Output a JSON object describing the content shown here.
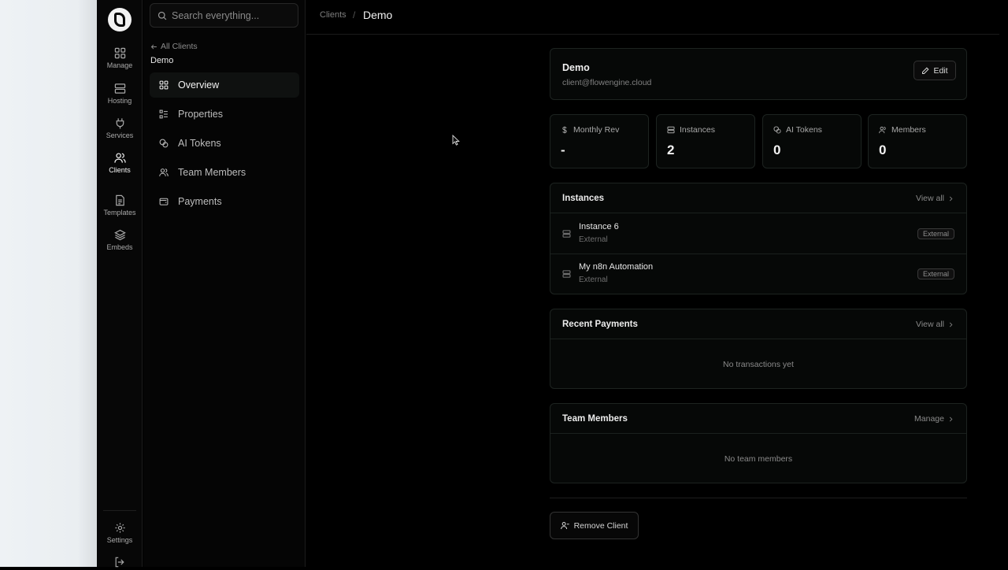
{
  "rail": {
    "items": [
      {
        "label": "Manage",
        "icon": "grid-icon"
      },
      {
        "label": "Hosting",
        "icon": "server-icon"
      },
      {
        "label": "Services",
        "icon": "plug-icon"
      },
      {
        "label": "Clients",
        "icon": "users-icon",
        "active": true
      },
      {
        "label": "Templates",
        "icon": "document-icon"
      },
      {
        "label": "Embeds",
        "icon": "layers-icon"
      }
    ],
    "settings_label": "Settings"
  },
  "search": {
    "placeholder": "Search everything..."
  },
  "subnav": {
    "back_label": "All Clients",
    "client_name": "Demo",
    "items": [
      {
        "label": "Overview",
        "icon": "dashboard-icon",
        "active": true
      },
      {
        "label": "Properties",
        "icon": "list-icon"
      },
      {
        "label": "AI Tokens",
        "icon": "coins-icon"
      },
      {
        "label": "Team Members",
        "icon": "team-icon"
      },
      {
        "label": "Payments",
        "icon": "wallet-icon"
      }
    ]
  },
  "breadcrumb": {
    "parent": "Clients",
    "separator": "/",
    "current": "Demo"
  },
  "profile": {
    "name": "Demo",
    "email": "client@flowengine.cloud",
    "edit_label": "Edit"
  },
  "stats": [
    {
      "label": "Monthly Rev",
      "value": "-",
      "icon": "dollar-icon"
    },
    {
      "label": "Instances",
      "value": "2",
      "icon": "server-icon"
    },
    {
      "label": "AI Tokens",
      "value": "0",
      "icon": "coins-icon"
    },
    {
      "label": "Members",
      "value": "0",
      "icon": "users-icon"
    }
  ],
  "instances": {
    "title": "Instances",
    "view_all": "View all",
    "rows": [
      {
        "name": "Instance 6",
        "type": "External",
        "badge": "External"
      },
      {
        "name": "My n8n Automation",
        "type": "External",
        "badge": "External"
      }
    ]
  },
  "payments": {
    "title": "Recent Payments",
    "view_all": "View all",
    "empty": "No transactions yet"
  },
  "team": {
    "title": "Team Members",
    "manage": "Manage",
    "empty": "No team members"
  },
  "remove_label": "Remove Client",
  "colors": {
    "background": "#000000",
    "card": "#060807",
    "border": "#1d2320",
    "text": "#e7e7e7",
    "muted": "#8a8a8a"
  }
}
